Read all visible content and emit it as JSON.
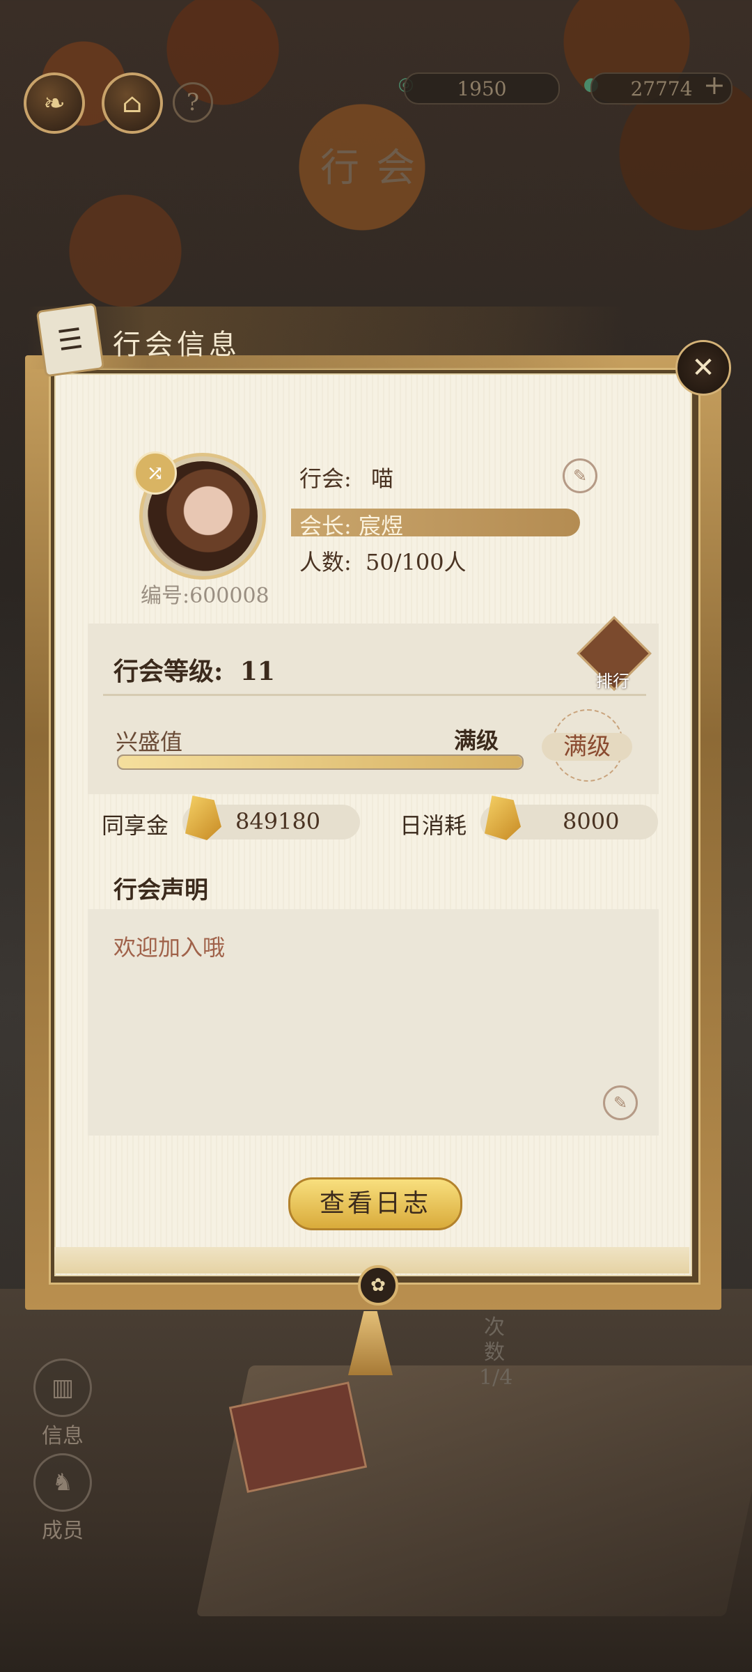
{
  "top_bar": {
    "currency_1": "1950",
    "currency_2": "27774",
    "add_label": "+",
    "help_label": "?"
  },
  "page_title": "行会",
  "panel": {
    "title": "行会信息",
    "close_label": "✕"
  },
  "guild": {
    "name_label": "行会:",
    "name": "喵",
    "leader_label": "会长:",
    "leader": "宸煜",
    "members_label": "人数:",
    "members": "50/100人",
    "id": "编号:600008"
  },
  "level": {
    "label": "行会等级:",
    "value": "11",
    "rank_label": "排行",
    "prosperity_label": "兴盛值",
    "prosperity_status": "满级",
    "prosperity_fill": 1.0,
    "max_badge": "满级"
  },
  "funds": {
    "shared_label": "同享金",
    "shared_value": "849180",
    "daily_label": "日消耗",
    "daily_value": "8000"
  },
  "declaration": {
    "title": "行会声明",
    "text": "欢迎加入哦"
  },
  "log_button": "查看日志",
  "count": {
    "label_1": "次",
    "label_2": "数",
    "value": "1/4"
  },
  "side_nav": [
    {
      "label": "信息"
    },
    {
      "label": "成员"
    }
  ],
  "colors": {
    "accent_gold": "#d9ab3b",
    "paper": "#f6f1e3",
    "text_dark": "#3b2a1c"
  }
}
